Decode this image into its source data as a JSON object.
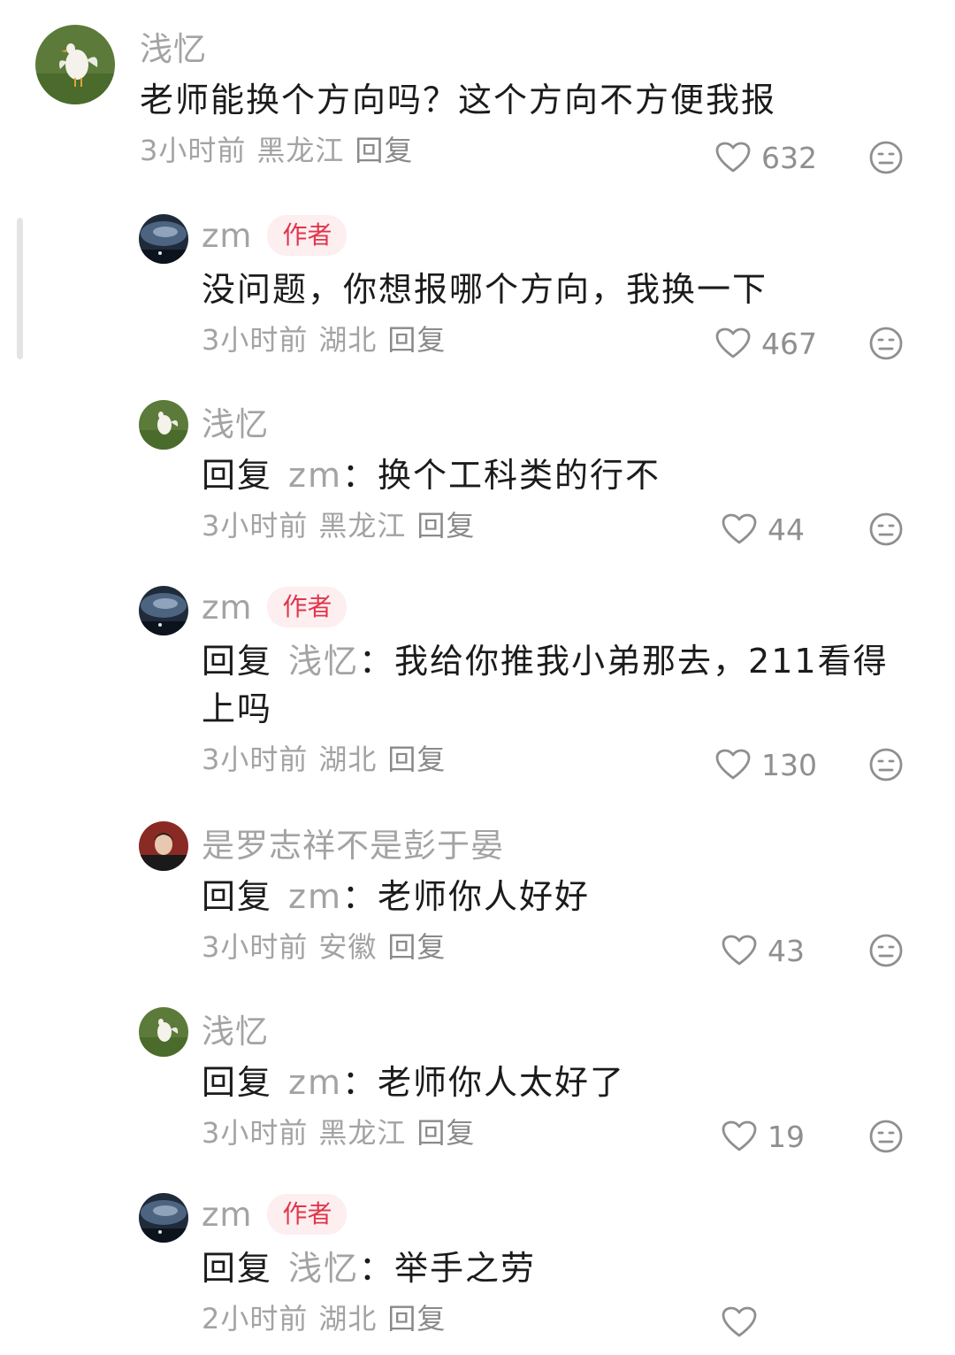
{
  "comments": [
    {
      "nickname": "浅忆",
      "is_author": false,
      "text": "老师能换个方向吗？这个方向不方便我报",
      "time": "3小时前",
      "location": "黑龙江",
      "reply_label": "回复",
      "likes": "632",
      "avatar": "goose"
    },
    {
      "nickname": "zm",
      "is_author": true,
      "author_badge": "作者",
      "text": "没问题，你想报哪个方向，我换一下",
      "time": "3小时前",
      "location": "湖北",
      "reply_label": "回复",
      "likes": "467",
      "avatar": "night-sky"
    },
    {
      "nickname": "浅忆",
      "is_author": false,
      "reply_prefix": "回复",
      "reply_to": "zm",
      "text": "换个工科类的行不",
      "time": "3小时前",
      "location": "黑龙江",
      "reply_label": "回复",
      "likes": "44",
      "avatar": "goose"
    },
    {
      "nickname": "zm",
      "is_author": true,
      "author_badge": "作者",
      "reply_prefix": "回复",
      "reply_to": "浅忆",
      "text": "我给你推我小弟那去，211看得上吗",
      "time": "3小时前",
      "location": "湖北",
      "reply_label": "回复",
      "likes": "130",
      "avatar": "night-sky"
    },
    {
      "nickname": "是罗志祥不是彭于晏",
      "is_author": false,
      "reply_prefix": "回复",
      "reply_to": "zm",
      "text": "老师你人好好",
      "time": "3小时前",
      "location": "安徽",
      "reply_label": "回复",
      "likes": "43",
      "avatar": "portrait"
    },
    {
      "nickname": "浅忆",
      "is_author": false,
      "reply_prefix": "回复",
      "reply_to": "zm",
      "text": "老师你人太好了",
      "time": "3小时前",
      "location": "黑龙江",
      "reply_label": "回复",
      "likes": "19",
      "avatar": "goose"
    },
    {
      "nickname": "zm",
      "is_author": true,
      "author_badge": "作者",
      "reply_prefix": "回复",
      "reply_to": "浅忆",
      "text": "举手之劳",
      "time": "2小时前",
      "location": "湖北",
      "reply_label": "回复",
      "likes": "",
      "avatar": "night-sky"
    }
  ],
  "colon": "：",
  "icons": {
    "like": "heart-icon",
    "dislike": "dislike-face-icon"
  },
  "colors": {
    "author_badge_bg": "#fdeef0",
    "author_badge_text": "#e0364c",
    "muted_text": "#a3a3a3",
    "body_text": "#1b1b1b"
  }
}
